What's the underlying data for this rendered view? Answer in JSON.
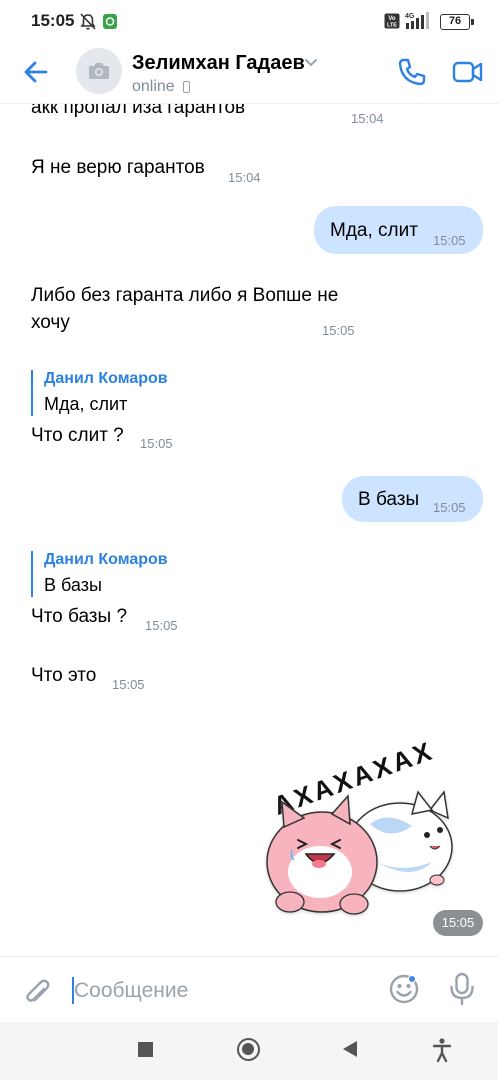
{
  "status_bar": {
    "time": "15:05",
    "battery": "76",
    "network": "4G",
    "volte": "Vo LTE",
    "icons": [
      "mute-icon",
      "app-notification-icon",
      "volte-icon",
      "signal-icon",
      "battery-icon"
    ]
  },
  "header": {
    "contact_name": "Зелимхан Гадаев",
    "status": "online",
    "icons": [
      "back-arrow-icon",
      "camera-avatar-icon",
      "chevron-down-icon",
      "mobile-phone-icon",
      "phone-call-icon",
      "video-call-icon"
    ]
  },
  "messages": [
    {
      "type": "incoming",
      "text": "акк пропал иза гарантов",
      "time": "15:04"
    },
    {
      "type": "incoming",
      "text": "Я не верю гарантов",
      "time": "15:04"
    },
    {
      "type": "outgoing",
      "text": "Мда, слит",
      "time": "15:05"
    },
    {
      "type": "incoming",
      "line1": "Либо без гаранта либо я Вопше не",
      "line2": "хочу",
      "time": "15:05"
    },
    {
      "type": "incoming",
      "reply_author": "Данил Комаров",
      "reply_text": "Мда, слит",
      "text": "Что слит ?",
      "time": "15:05"
    },
    {
      "type": "outgoing",
      "text": "В базы",
      "time": "15:05"
    },
    {
      "type": "incoming",
      "reply_author": "Данил Комаров",
      "reply_text": "В базы",
      "text": "Что базы ?",
      "time": "15:05"
    },
    {
      "type": "incoming",
      "text": "Что это",
      "time": "15:05"
    },
    {
      "type": "sticker",
      "sticker_text": "АХАХАХАХ",
      "time": "15:05"
    }
  ],
  "composer": {
    "placeholder": "Сообщение",
    "icons": [
      "paperclip-icon",
      "emoji-icon",
      "microphone-icon"
    ]
  },
  "colors": {
    "accent": "#2d81e0",
    "outgoing_bubble": "#cce4ff",
    "secondary_text": "#818c99"
  }
}
